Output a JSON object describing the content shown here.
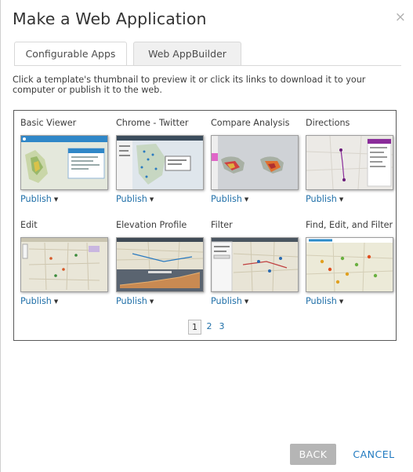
{
  "dialog": {
    "title": "Make a Web Application",
    "close_glyph": "×"
  },
  "tabs": [
    {
      "label": "Configurable Apps",
      "active": true
    },
    {
      "label": "Web AppBuilder",
      "active": false
    }
  ],
  "instructions": "Click a template's thumbnail to preview it or click its links to download it to your computer or publish it to the web.",
  "templates": [
    {
      "title": "Basic Viewer",
      "action": "Publish"
    },
    {
      "title": "Chrome - Twitter",
      "action": "Publish"
    },
    {
      "title": "Compare Analysis",
      "action": "Publish"
    },
    {
      "title": "Directions",
      "action": "Publish"
    },
    {
      "title": "Edit",
      "action": "Publish"
    },
    {
      "title": "Elevation Profile",
      "action": "Publish"
    },
    {
      "title": "Filter",
      "action": "Publish"
    },
    {
      "title": "Find, Edit, and Filter",
      "action": "Publish"
    }
  ],
  "pagination": {
    "pages": [
      "1",
      "2",
      "3"
    ],
    "current": "1"
  },
  "footer": {
    "back_label": "BACK",
    "cancel_label": "CANCEL"
  },
  "colors": {
    "link": "#1f6fa8",
    "accent": "#1f79c0",
    "back_button": "#b5b5b5",
    "border": "#595959"
  },
  "icons": {
    "close": "close-icon",
    "dropdown": "caret-down-icon"
  }
}
